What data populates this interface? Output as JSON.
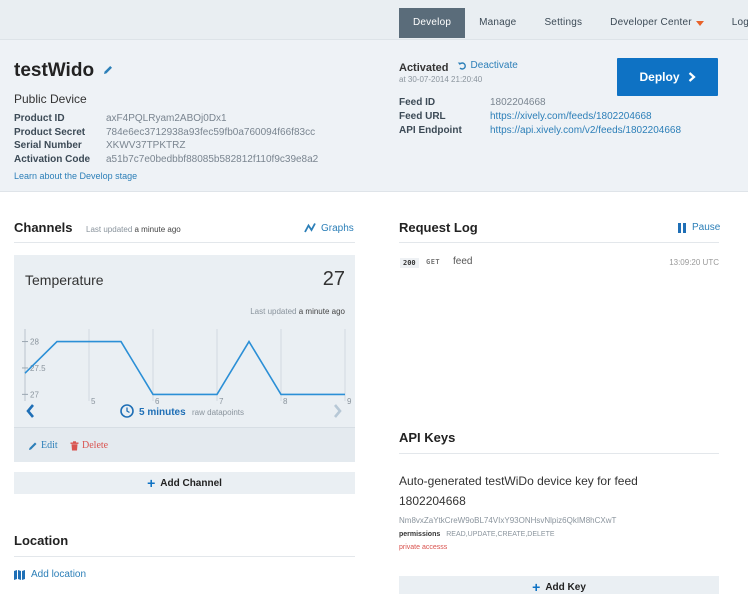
{
  "nav": {
    "items": [
      "Develop",
      "Manage",
      "Settings",
      "Developer Center",
      "Logout"
    ],
    "active": "Develop"
  },
  "device": {
    "name": "testWido",
    "type": "Public Device",
    "fields": [
      {
        "label": "Product ID",
        "value": "axF4PQLRyam2ABOj0Dx1"
      },
      {
        "label": "Product Secret",
        "value": "784e6ec3712938a93fec59fb0a760094f66f83cc"
      },
      {
        "label": "Serial Number",
        "value": "XKWV37TPKTRZ"
      },
      {
        "label": "Activation Code",
        "value": "a51b7c7e0bedbbf88085b582812f110f9c39e8a2"
      }
    ],
    "learn_link": "Learn about the Develop stage"
  },
  "activation": {
    "status": "Activated",
    "deactivate": "Deactivate",
    "time": "at 30-07-2014 21:20:40",
    "deploy": "Deploy"
  },
  "feed": {
    "fields": [
      {
        "label": "Feed ID",
        "value": "1802204668",
        "link": false
      },
      {
        "label": "Feed URL",
        "value": "https://xively.com/feeds/1802204668",
        "link": true
      },
      {
        "label": "API Endpoint",
        "value": "https://api.xively.com/v2/feeds/1802204668",
        "link": true
      }
    ]
  },
  "channels": {
    "title": "Channels",
    "updated_prefix": "Last updated",
    "updated_when": "a minute ago",
    "graphs": "Graphs",
    "card": {
      "name": "Temperature",
      "value": "27",
      "updated_prefix": "Last updated",
      "updated_when": "a minute ago",
      "window": "5 minutes",
      "window_sub": "raw datapoints",
      "edit": "Edit",
      "delete": "Delete"
    },
    "add": "Add Channel"
  },
  "chart_data": {
    "type": "line",
    "title": "",
    "x": [
      4,
      4.5,
      5,
      5.5,
      6,
      6.5,
      7,
      7.5,
      8,
      8.5,
      9
    ],
    "y": [
      27.4,
      28,
      28,
      28,
      27,
      27,
      27,
      28,
      27,
      27,
      27
    ],
    "x_ticks": [
      "5",
      "6",
      "7",
      "8",
      "9"
    ],
    "y_ticks": [
      "27",
      "27.5",
      "28"
    ],
    "xlim": [
      4,
      9
    ],
    "ylim": [
      26.95,
      28.2
    ],
    "grid": true,
    "color": "#2b8fd6"
  },
  "location": {
    "title": "Location",
    "add": "Add location"
  },
  "request_log": {
    "title": "Request Log",
    "pause": "Pause",
    "entries": [
      {
        "status": "200",
        "method": "GET",
        "resource": "feed",
        "time": "13:09:20 UTC"
      }
    ]
  },
  "api_keys": {
    "title": "API Keys",
    "description": "Auto-generated testWiDo device key for feed 1802204668",
    "key": "Nm8vxZaYtkCreW9oBL74VIxY93ONHsvNlpiz6QkIM8hCXwT",
    "permissions_label": "permissions",
    "permissions": "READ,UPDATE,CREATE,DELETE",
    "private": "private accesss",
    "add": "Add Key"
  },
  "colors": {
    "accent": "#0e72c4",
    "link": "#2c7fb8",
    "danger": "#d9534f",
    "nav_active": "#5a6c7a"
  }
}
